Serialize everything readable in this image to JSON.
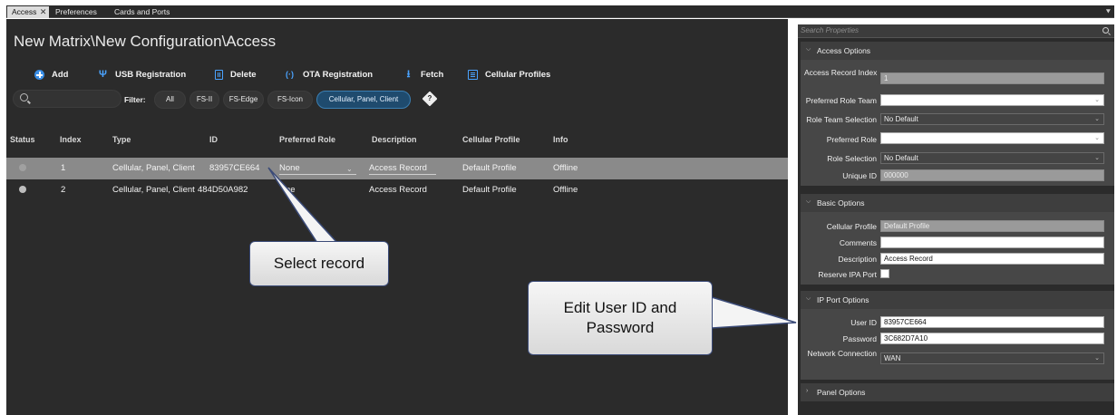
{
  "tabs": [
    {
      "label": "Access",
      "active": true
    },
    {
      "label": "Preferences",
      "active": false
    },
    {
      "label": "Cards and Ports",
      "active": false
    }
  ],
  "tab_close": "✕",
  "tab_menu": "⯆",
  "page_title": "New Matrix\\New Configuration\\Access",
  "toolbar": {
    "add": "Add",
    "usb": "USB Registration",
    "delete": "Delete",
    "ota": "OTA Registration",
    "fetch": "Fetch",
    "cellular": "Cellular Profiles"
  },
  "filter": {
    "label": "Filter:",
    "chips": [
      "All",
      "FS-II",
      "FS-Edge",
      "FS-Icon",
      "Cellular, Panel, Client"
    ],
    "selected": "Cellular, Panel, Client",
    "help": "?"
  },
  "table": {
    "columns": [
      "Status",
      "Index",
      "Type",
      "ID",
      "Preferred Role",
      "Description",
      "Cellular Profile",
      "Info"
    ],
    "rows": [
      {
        "index": "1",
        "type": "Cellular, Panel, Client",
        "id": "83957CE664",
        "role": "None",
        "description": "Access Record",
        "profile": "Default Profile",
        "info": "Offline",
        "selected": true
      },
      {
        "index": "2",
        "type": "Cellular, Panel, Client",
        "id": "484D50A982",
        "role": "ne",
        "description": "Access Record",
        "profile": "Default Profile",
        "info": "Offline",
        "selected": false
      }
    ]
  },
  "properties": {
    "search_placeholder": "Search Properties",
    "access_options": {
      "title": "Access Options",
      "access_record_index_label": "Access Record Index",
      "access_record_index_value": "1",
      "preferred_role_team_label": "Preferred Role Team",
      "preferred_role_team_value": "",
      "role_team_selection_label": "Role Team Selection",
      "role_team_selection_value": "No Default",
      "preferred_role_label": "Preferred Role",
      "preferred_role_value": "",
      "role_selection_label": "Role Selection",
      "role_selection_value": "No Default",
      "unique_id_label": "Unique ID",
      "unique_id_value": "000000"
    },
    "basic_options": {
      "title": "Basic Options",
      "cellular_profile_label": "Cellular Profile",
      "cellular_profile_value": "Default Profile",
      "comments_label": "Comments",
      "comments_value": "",
      "description_label": "Description",
      "description_value": "Access Record",
      "reserve_ipa_port_label": "Reserve IPA Port",
      "reserve_ipa_port_checked": false
    },
    "ip_port_options": {
      "title": "IP Port Options",
      "user_id_label": "User ID",
      "user_id_value": "83957CE664",
      "password_label": "Password",
      "password_value": "3C682D7A10",
      "network_connection_label": "Network Connection",
      "network_connection_value": "WAN"
    },
    "panel_options": {
      "title": "Panel Options"
    }
  },
  "callouts": {
    "select_record": "Select record",
    "edit_user": "Edit User ID and Password"
  },
  "colors": {
    "accent": "#4aa3ff",
    "selected_row": "#8a8a8a",
    "callout_border": "#3b4b78"
  }
}
